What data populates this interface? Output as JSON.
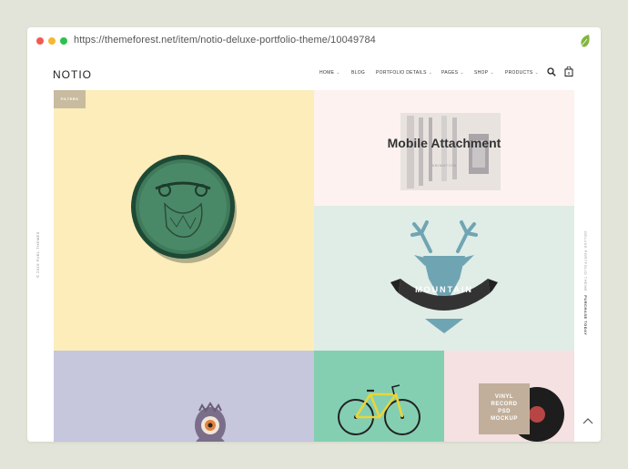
{
  "browser": {
    "url": "https://themeforest.net/item/notio-deluxe-portfolio-theme/10049784"
  },
  "site": {
    "logo": "NOTIO",
    "nav": [
      {
        "label": "HOME",
        "has_dropdown": true
      },
      {
        "label": "BLOG",
        "has_dropdown": false
      },
      {
        "label": "PORTFOLIO DETAILS",
        "has_dropdown": true
      },
      {
        "label": "PAGES",
        "has_dropdown": true
      },
      {
        "label": "SHOP",
        "has_dropdown": true
      },
      {
        "label": "PRODUCTS",
        "has_dropdown": true
      }
    ],
    "cart_count": "0",
    "side_left": "© 2016 FUEL THEMES",
    "side_right": "DELUXE PORTFOLIO THEME",
    "side_right_bold": "PURCHASE TODAY"
  },
  "grid": {
    "filters_label": "FILTERS",
    "mobile_title": "Mobile Attachment",
    "mobile_category": "ANIMATION",
    "mountain_label": "MOUNTAIN",
    "record_text": [
      "VINYL",
      "RECORD",
      "PSD",
      "MOCKUP"
    ]
  },
  "colors": {
    "tile_yellow": "#fcedbb",
    "tile_pink": "#fdf2ef",
    "tile_mint": "#e0ece6",
    "tile_lavender": "#c6c6dc",
    "tile_teal": "#84cfb2",
    "tile_rose": "#f5e1e1",
    "filters_bg": "#c8bb9f"
  }
}
